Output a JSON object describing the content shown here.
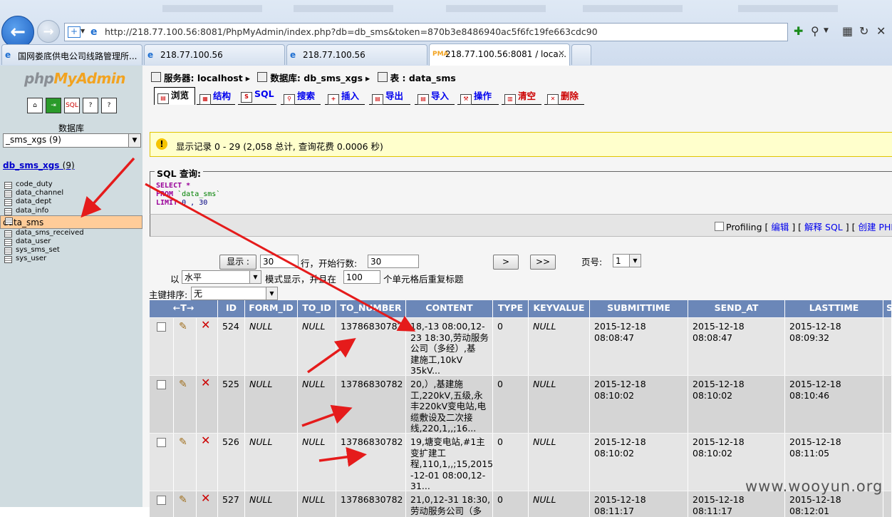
{
  "browser": {
    "address": "http://218.77.100.56:8081/PhpMyAdmin/index.php?db=db_sms&token=870b3e8486940ac5f6fc19fe663cdc90",
    "tabs": [
      {
        "label": "国网娄底供电公司线路管理所..."
      },
      {
        "label": "218.77.100.56"
      },
      {
        "label": "218.77.100.56"
      },
      {
        "label": "218.77.100.56:8081 / loca..."
      }
    ]
  },
  "sidebar": {
    "logo_php": "php",
    "logo_my": "MyAdmin",
    "db_label": "数据库",
    "db_select": "_sms_xgs (9)",
    "db_name": "db_sms_xgs",
    "db_count": "(9)",
    "tables": [
      "code_duty",
      "data_channel",
      "data_dept",
      "data_info",
      "data_sms",
      "data_sms_received",
      "data_user",
      "sys_sms_set",
      "sys_user"
    ],
    "selected_table": "data_sms"
  },
  "breadcrumb": {
    "server": "服务器: localhost",
    "database": "数据库: db_sms_xgs",
    "table": "表 : data_sms"
  },
  "tabs": [
    {
      "label": "浏览"
    },
    {
      "label": "结构"
    },
    {
      "label": "SQL"
    },
    {
      "label": "搜索"
    },
    {
      "label": "插入"
    },
    {
      "label": "导出"
    },
    {
      "label": "导入"
    },
    {
      "label": "操作"
    },
    {
      "label": "清空"
    },
    {
      "label": "删除"
    }
  ],
  "notice": "显示记录 0 - 29 (2,058 总计, 查询花费 0.0006 秒)",
  "sql": {
    "legend": "SQL 查询:",
    "line1_kw": "SELECT",
    "line1_rest": " *",
    "line2_kw": "FROM",
    "line2_rest": " `data_sms`",
    "line3_kw": "LIMIT",
    "line3_rest": " 0 , 30"
  },
  "profiling": {
    "label": "Profiling",
    "edit": "编辑",
    "explain": "解释 SQL",
    "create_php": "创建 PHP"
  },
  "nav": {
    "show_btn": "显示 :",
    "rows": "30",
    "rows_text": "行，开始行数:",
    "start": "30",
    "next": ">",
    "last": ">>",
    "page_label": "页号:",
    "page": "1",
    "mode_prefix": "以",
    "mode": "水平",
    "mode_text": "模式显示，并且在",
    "repeat": "100",
    "repeat_text": "个单元格后重复标题",
    "sort_label": "主键排序:",
    "sort": "无"
  },
  "table": {
    "headers": [
      "ID",
      "FORM_ID",
      "TO_ID",
      "TO_NUMBER",
      "CONTENT",
      "TYPE",
      "KEYVALUE",
      "SUBMITTIME",
      "SEND_AT",
      "LASTTIME",
      "S"
    ],
    "rows": [
      {
        "id": "524",
        "form_id": "NULL",
        "to_id": "NULL",
        "to_number": "13786830782",
        "content": [
          "18,-13 08:00,12-",
          "23 18:30,劳动服务",
          "公司（多经）,基",
          "建施工,10kV",
          "35kV..."
        ],
        "type": "0",
        "keyvalue": "NULL",
        "submittime": "2015-12-18 08:08:47",
        "send_at": "2015-12-18 08:08:47",
        "lasttime": "2015-12-18 08:09:32"
      },
      {
        "id": "525",
        "form_id": "NULL",
        "to_id": "NULL",
        "to_number": "13786830782",
        "content": [
          "20,）,基建施",
          "工,220kV,五级,永",
          "丰220kV变电站,电",
          "缆敷设及二次接",
          "线,220,1,,;16..."
        ],
        "type": "0",
        "keyvalue": "NULL",
        "submittime": "2015-12-18 08:10:02",
        "send_at": "2015-12-18 08:10:02",
        "lasttime": "2015-12-18 08:10:46"
      },
      {
        "id": "526",
        "form_id": "NULL",
        "to_id": "NULL",
        "to_number": "13786830782",
        "content": [
          "19,塘变电站,#1主",
          "变扩建工",
          "程,110,1,,;15,2015",
          "-12-01 08:00,12-",
          "31..."
        ],
        "type": "0",
        "keyvalue": "NULL",
        "submittime": "2015-12-18 08:10:02",
        "send_at": "2015-12-18 08:10:02",
        "lasttime": "2015-12-18 08:11:05"
      },
      {
        "id": "527",
        "form_id": "NULL",
        "to_id": "NULL",
        "to_number": "13786830782",
        "content": [
          "21,0,12-31 18:30,",
          "劳动服务公司（多"
        ],
        "type": "0",
        "keyvalue": "NULL",
        "submittime": "2015-12-18 08:11:17",
        "send_at": "2015-12-18 08:11:17",
        "lasttime": "2015-12-18 08:12:01"
      }
    ]
  },
  "watermark": "www.wooyun.org",
  "colors": {
    "header_bg": "#6b87b8",
    "arrow": "#e51b1b",
    "selected_table": "#ffcc99",
    "notice_bg": "#ffffcc"
  }
}
